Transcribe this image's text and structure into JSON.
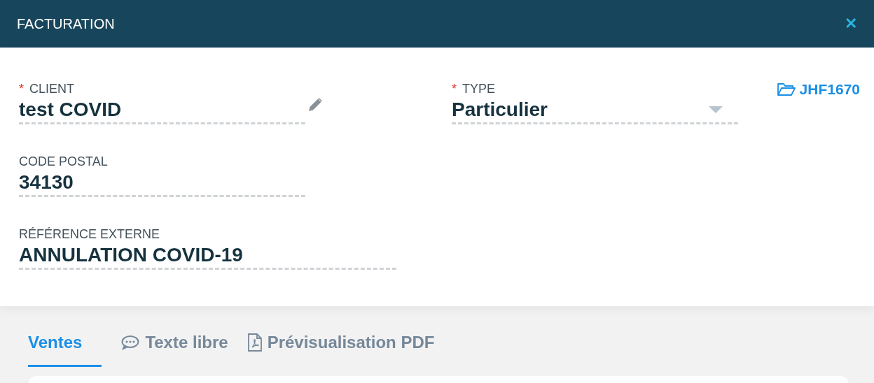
{
  "window": {
    "title": "FACTURATION",
    "close": "✕"
  },
  "fields": [
    {
      "label": "CLIENT",
      "value": "test COVID",
      "required_mark": "*",
      "kind": "edit"
    },
    {
      "label": "TYPE",
      "value": "Particulier",
      "required_mark": "*",
      "kind": "select"
    },
    {
      "label": "CODE POSTAL",
      "value": "34130",
      "kind": "text"
    },
    {
      "label": "RÉFÉRENCE EXTERNE",
      "value": "ANNULATION COVID-19",
      "kind": "wide"
    }
  ],
  "folder_link": "JHF1670",
  "tabs": [
    {
      "label": "Ventes",
      "selected": true,
      "kind": "plain"
    },
    {
      "label": "Texte libre",
      "selected": false,
      "kind": "comment"
    },
    {
      "label": "Prévisualisation PDF",
      "selected": false,
      "kind": "pdf"
    }
  ]
}
